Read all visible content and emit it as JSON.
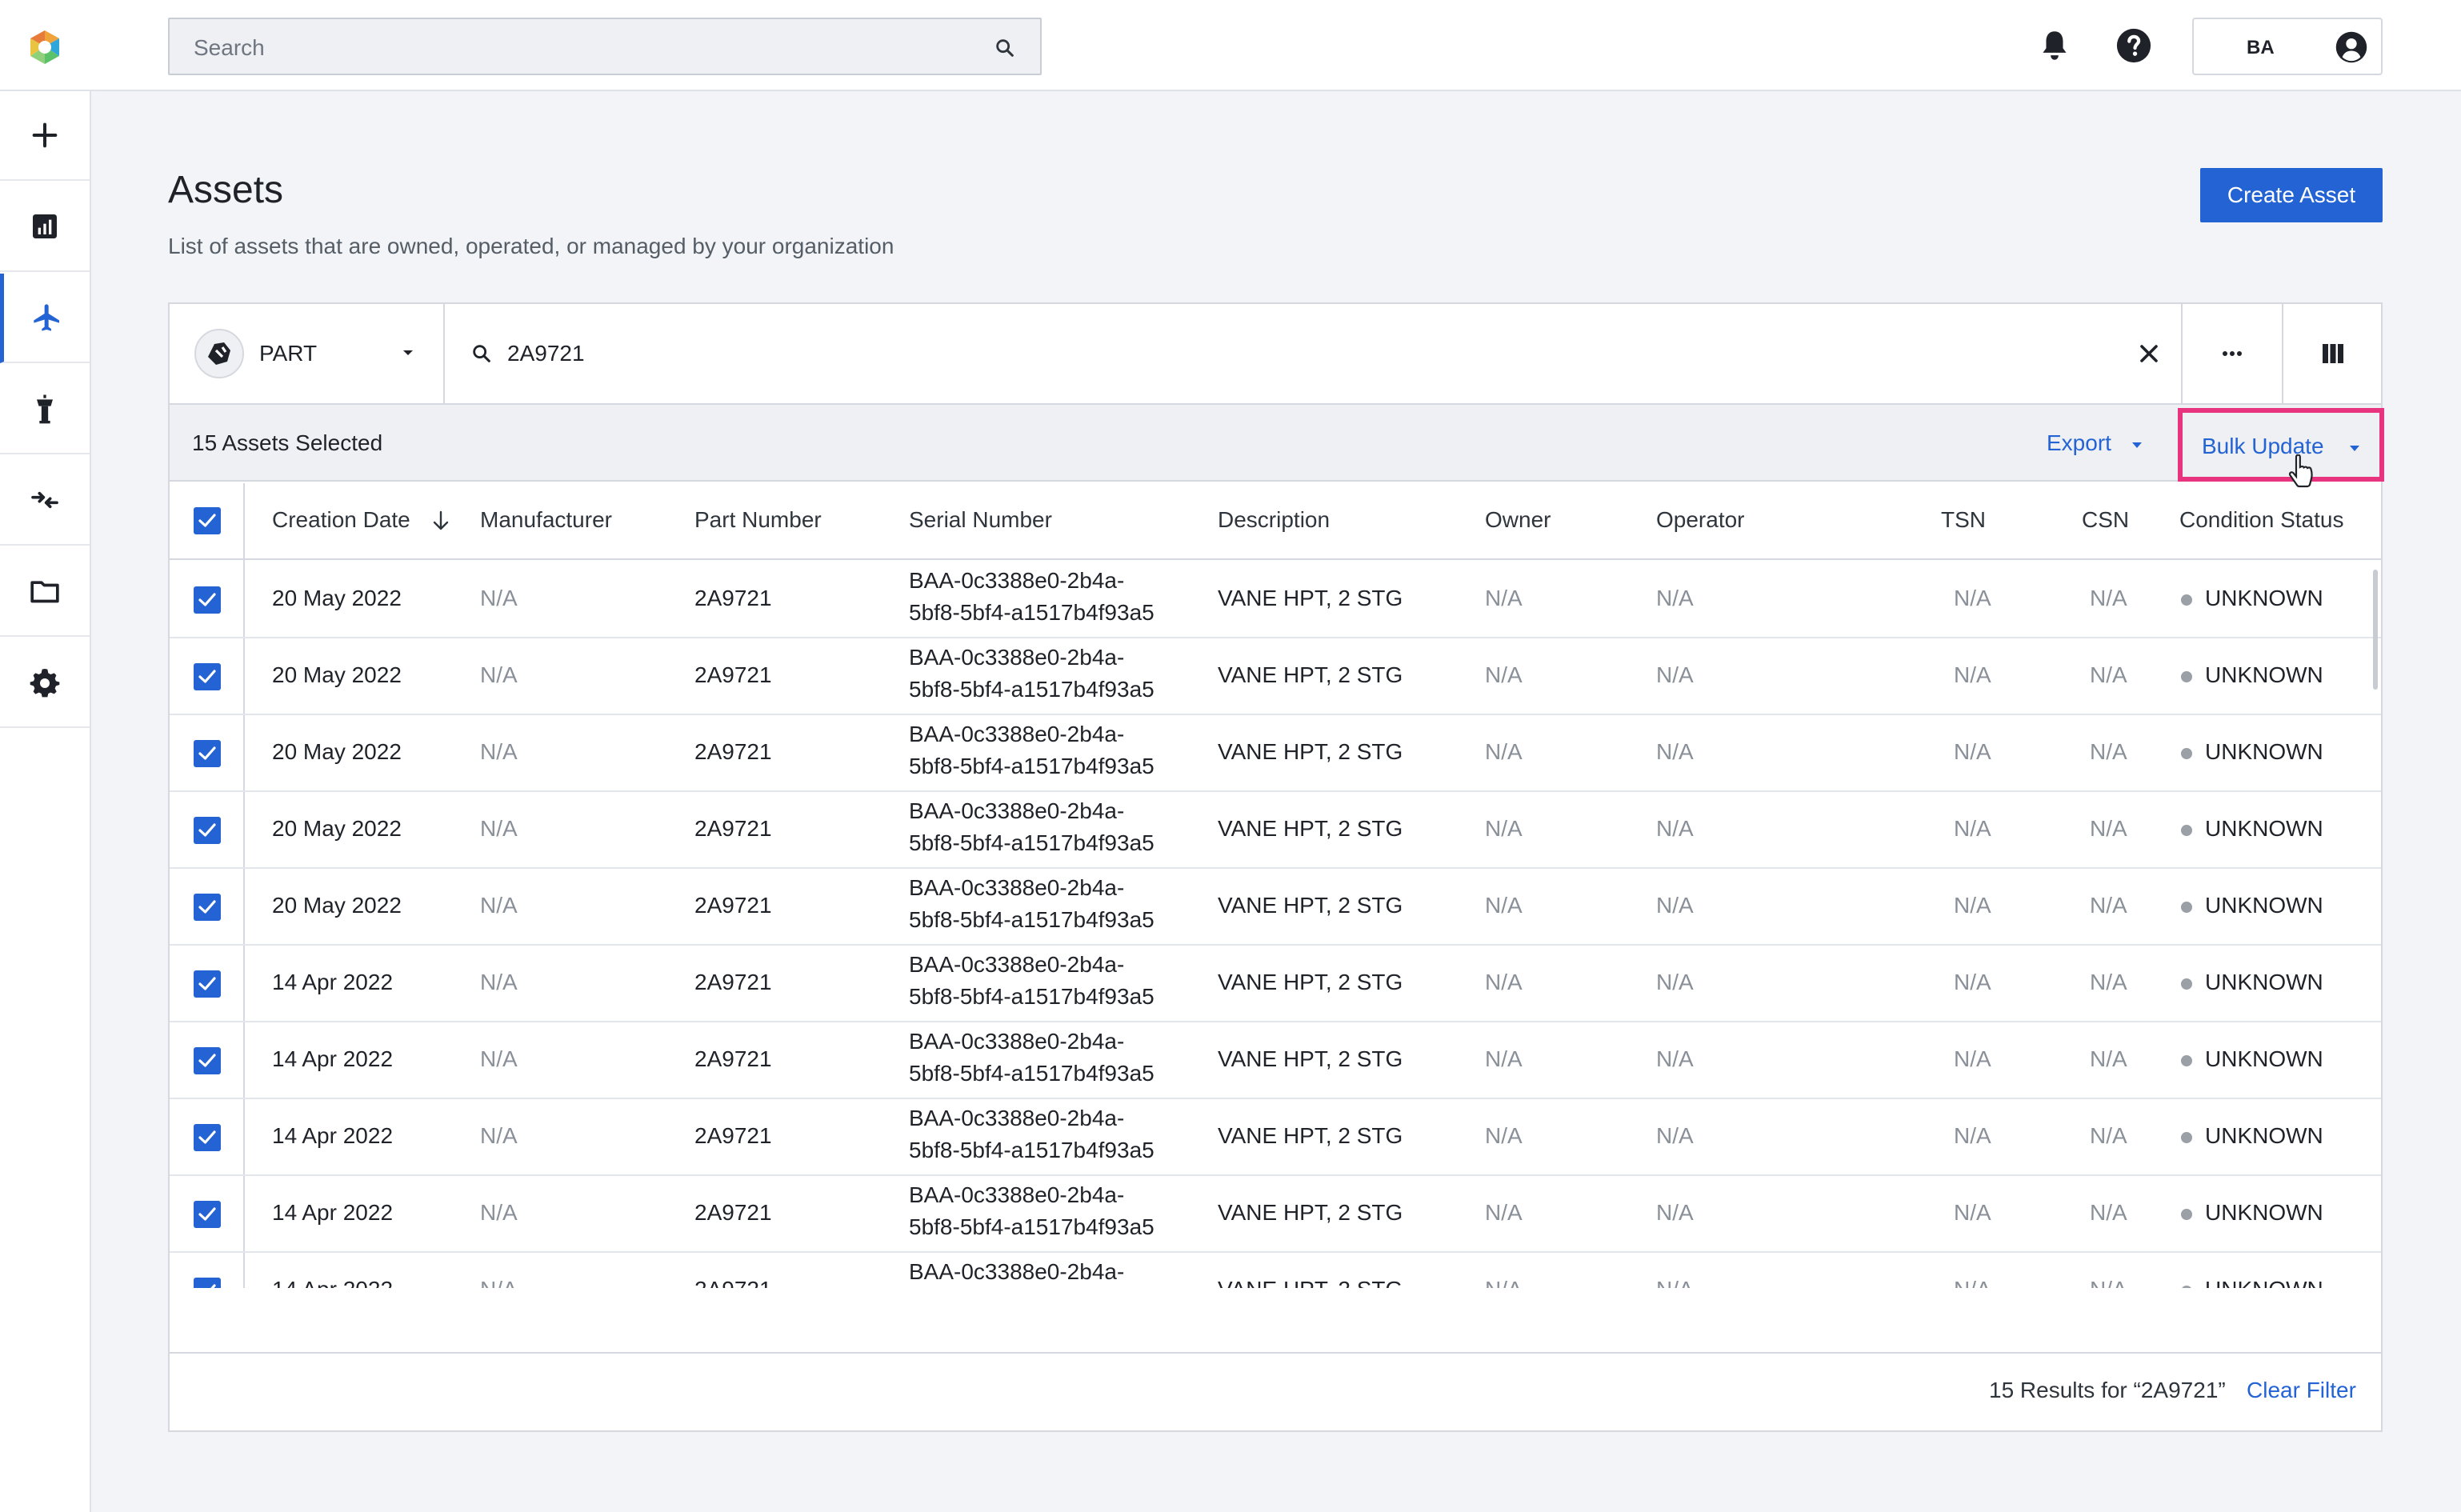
{
  "topbar": {
    "search_placeholder": "Search",
    "user_initials": "BA",
    "icons": [
      "logo",
      "search-icon",
      "bell-icon",
      "help-icon",
      "account-icon"
    ]
  },
  "sidenav": {
    "items": [
      {
        "name": "add",
        "icon": "plus-icon",
        "active": false
      },
      {
        "name": "reports",
        "icon": "chart-icon",
        "active": false
      },
      {
        "name": "assets",
        "icon": "airplane-icon",
        "active": true
      },
      {
        "name": "tower",
        "icon": "control-tower-icon",
        "active": false
      },
      {
        "name": "transfers",
        "icon": "transfer-icon",
        "active": false
      },
      {
        "name": "files",
        "icon": "folder-icon",
        "active": false
      },
      {
        "name": "settings",
        "icon": "gear-icon",
        "active": false
      }
    ]
  },
  "header": {
    "title": "Assets",
    "subtitle": "List of assets that are owned, operated, or managed by your organization",
    "create_label": "Create Asset"
  },
  "filter": {
    "type_label": "PART",
    "query": "2A9721"
  },
  "selection": {
    "count_label": "15 Assets Selected",
    "export_label": "Export",
    "bulk_label": "Bulk Update"
  },
  "table": {
    "headers": [
      "Creation Date",
      "Manufacturer",
      "Part Number",
      "Serial Number",
      "Description",
      "Owner",
      "Operator",
      "TSN",
      "CSN",
      "Condition Status"
    ],
    "rows": [
      {
        "date": "20 May 2022",
        "manufacturer": "N/A",
        "part": "2A9721",
        "serial1": "BAA-0c3388e0-2b4a-",
        "serial2": "5bf8-5bf4-a1517b4f93a5",
        "description": "VANE HPT, 2 STG",
        "owner": "N/A",
        "operator": "N/A",
        "tsn": "N/A",
        "csn": "N/A",
        "status": "UNKNOWN"
      },
      {
        "date": "20 May 2022",
        "manufacturer": "N/A",
        "part": "2A9721",
        "serial1": "BAA-0c3388e0-2b4a-",
        "serial2": "5bf8-5bf4-a1517b4f93a5",
        "description": "VANE HPT, 2 STG",
        "owner": "N/A",
        "operator": "N/A",
        "tsn": "N/A",
        "csn": "N/A",
        "status": "UNKNOWN"
      },
      {
        "date": "20 May 2022",
        "manufacturer": "N/A",
        "part": "2A9721",
        "serial1": "BAA-0c3388e0-2b4a-",
        "serial2": "5bf8-5bf4-a1517b4f93a5",
        "description": "VANE HPT, 2 STG",
        "owner": "N/A",
        "operator": "N/A",
        "tsn": "N/A",
        "csn": "N/A",
        "status": "UNKNOWN"
      },
      {
        "date": "20 May 2022",
        "manufacturer": "N/A",
        "part": "2A9721",
        "serial1": "BAA-0c3388e0-2b4a-",
        "serial2": "5bf8-5bf4-a1517b4f93a5",
        "description": "VANE HPT, 2 STG",
        "owner": "N/A",
        "operator": "N/A",
        "tsn": "N/A",
        "csn": "N/A",
        "status": "UNKNOWN"
      },
      {
        "date": "20 May 2022",
        "manufacturer": "N/A",
        "part": "2A9721",
        "serial1": "BAA-0c3388e0-2b4a-",
        "serial2": "5bf8-5bf4-a1517b4f93a5",
        "description": "VANE HPT, 2 STG",
        "owner": "N/A",
        "operator": "N/A",
        "tsn": "N/A",
        "csn": "N/A",
        "status": "UNKNOWN"
      },
      {
        "date": "14 Apr 2022",
        "manufacturer": "N/A",
        "part": "2A9721",
        "serial1": "BAA-0c3388e0-2b4a-",
        "serial2": "5bf8-5bf4-a1517b4f93a5",
        "description": "VANE HPT, 2 STG",
        "owner": "N/A",
        "operator": "N/A",
        "tsn": "N/A",
        "csn": "N/A",
        "status": "UNKNOWN"
      },
      {
        "date": "14 Apr 2022",
        "manufacturer": "N/A",
        "part": "2A9721",
        "serial1": "BAA-0c3388e0-2b4a-",
        "serial2": "5bf8-5bf4-a1517b4f93a5",
        "description": "VANE HPT, 2 STG",
        "owner": "N/A",
        "operator": "N/A",
        "tsn": "N/A",
        "csn": "N/A",
        "status": "UNKNOWN"
      },
      {
        "date": "14 Apr 2022",
        "manufacturer": "N/A",
        "part": "2A9721",
        "serial1": "BAA-0c3388e0-2b4a-",
        "serial2": "5bf8-5bf4-a1517b4f93a5",
        "description": "VANE HPT, 2 STG",
        "owner": "N/A",
        "operator": "N/A",
        "tsn": "N/A",
        "csn": "N/A",
        "status": "UNKNOWN"
      },
      {
        "date": "14 Apr 2022",
        "manufacturer": "N/A",
        "part": "2A9721",
        "serial1": "BAA-0c3388e0-2b4a-",
        "serial2": "5bf8-5bf4-a1517b4f93a5",
        "description": "VANE HPT, 2 STG",
        "owner": "N/A",
        "operator": "N/A",
        "tsn": "N/A",
        "csn": "N/A",
        "status": "UNKNOWN"
      },
      {
        "date": "14 Apr 2022",
        "manufacturer": "N/A",
        "part": "2A9721",
        "serial1": "BAA-0c3388e0-2b4a-",
        "serial2": "5bf8-5bf4-a1517b4f93a5",
        "description": "VANE HPT, 2 STG",
        "owner": "N/A",
        "operator": "N/A",
        "tsn": "N/A",
        "csn": "N/A",
        "status": "UNKNOWN"
      },
      {
        "date": "",
        "manufacturer": "",
        "part": "",
        "serial1": "BAA-0c3388e0-2b4a-",
        "serial2": "",
        "description": "",
        "owner": "",
        "operator": "",
        "tsn": "",
        "csn": "",
        "status": ""
      }
    ]
  },
  "footer": {
    "results_label": "15 Results for “2A9721”",
    "clear_label": "Clear Filter"
  },
  "colors": {
    "accent": "#2463d4",
    "highlight": "#e8337e",
    "status_unknown": "#9aa0a6"
  }
}
